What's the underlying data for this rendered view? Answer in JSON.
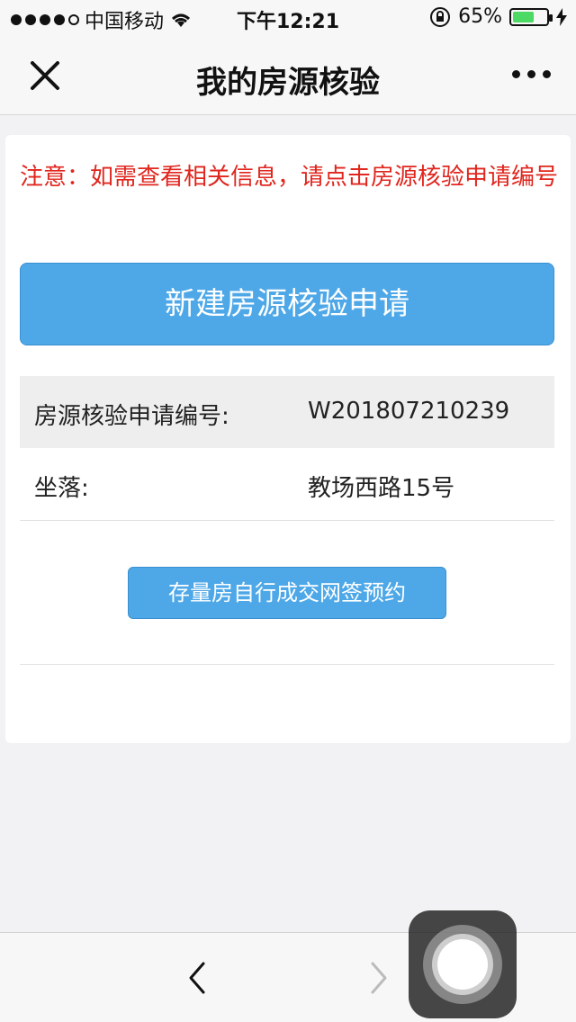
{
  "status_bar": {
    "carrier": "中国移动",
    "time": "下午12:21",
    "battery_percent_label": "65%",
    "battery_level": 0.65
  },
  "navbar": {
    "title": "我的房源核验"
  },
  "notice": {
    "text": "注意：如需查看相关信息，请点击房源核验申请编号"
  },
  "buttons": {
    "new_application": "新建房源核验申请",
    "online_sign_reservation": "存量房自行成交网签预约"
  },
  "records": [
    {
      "label": "房源核验申请编号:",
      "value": "W201807210239"
    },
    {
      "label": "坐落:",
      "value": "教场西路15号"
    }
  ],
  "colors": {
    "accent": "#4ea8e8",
    "notice": "#e0261e",
    "battery": "#4cd964"
  },
  "icons": {
    "close": "close-icon",
    "more": "more-horizontal-icon",
    "back": "chevron-left-icon",
    "forward": "chevron-right-icon",
    "wifi": "wifi-icon",
    "lock": "orientation-lock-icon",
    "charging": "charging-bolt-icon"
  }
}
